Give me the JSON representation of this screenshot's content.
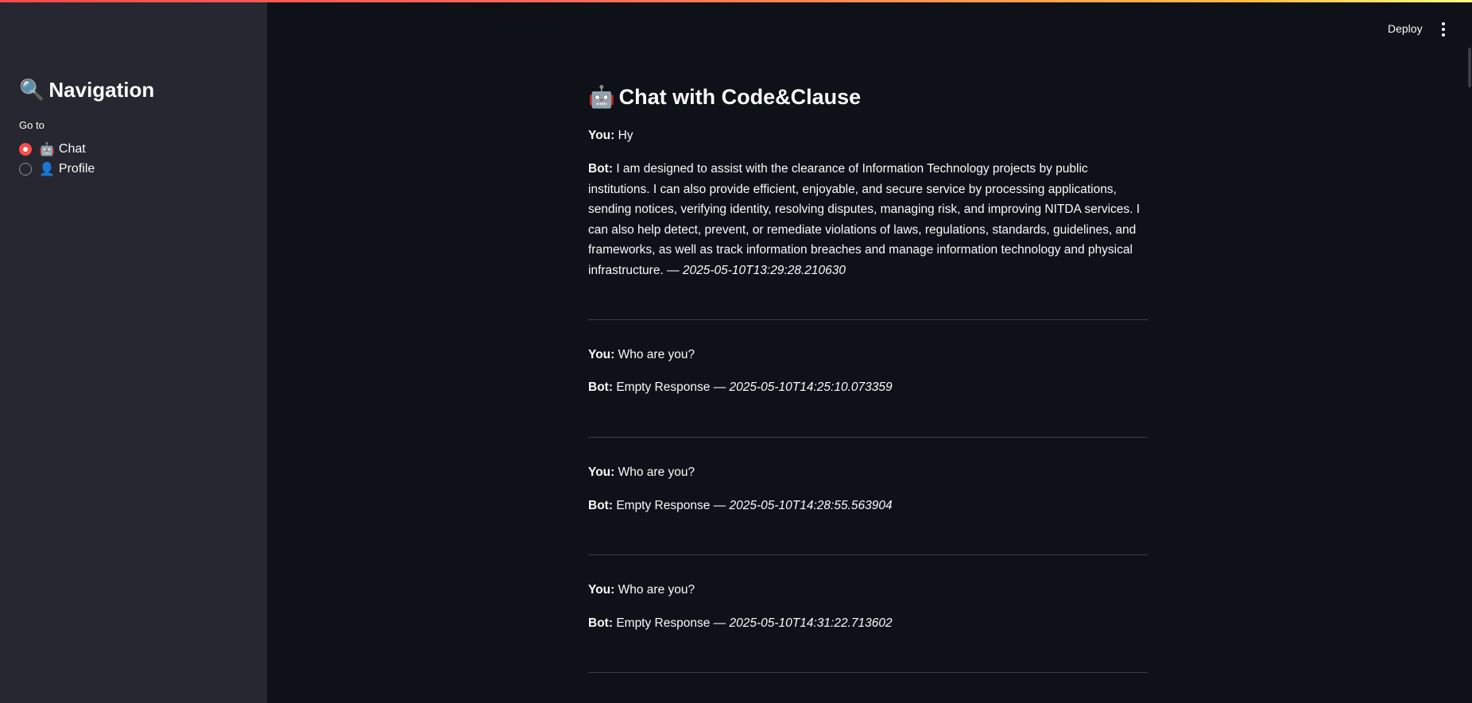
{
  "sidebar": {
    "title_icon": "🔍",
    "title": "Navigation",
    "goto_label": "Go to",
    "options": [
      {
        "icon": "🤖",
        "label": "Chat",
        "selected": true
      },
      {
        "icon": "👤",
        "label": "Profile",
        "selected": false
      }
    ]
  },
  "header": {
    "deploy_label": "Deploy",
    "menu_icon": "vertical-dots-icon"
  },
  "main": {
    "title_icon": "🤖",
    "title": "Chat with Code&Clause",
    "you_label": "You:",
    "bot_label": "Bot:",
    "separator": "—",
    "messages": [
      {
        "you": "Hy",
        "bot": "I am designed to assist with the clearance of Information Technology projects by public institutions. I can also provide efficient, enjoyable, and secure service by processing applications, sending notices, verifying identity, resolving disputes, managing risk, and improving NITDA services. I can also help detect, prevent, or remediate violations of laws, regulations, standards, guidelines, and frameworks, as well as track information breaches and manage information technology and physical infrastructure.",
        "timestamp": "2025-05-10T13:29:28.210630"
      },
      {
        "you": "Who are you?",
        "bot": "Empty Response",
        "timestamp": "2025-05-10T14:25:10.073359"
      },
      {
        "you": "Who are you?",
        "bot": "Empty Response",
        "timestamp": "2025-05-10T14:28:55.563904"
      },
      {
        "you": "Who are you?",
        "bot": "Empty Response",
        "timestamp": "2025-05-10T14:31:22.713602"
      }
    ]
  },
  "colors": {
    "accent": "#ff4b4b",
    "background": "#0e1117",
    "sidebar_bg": "#262730",
    "text": "#fafafa",
    "divider": "#3d3f4a"
  }
}
